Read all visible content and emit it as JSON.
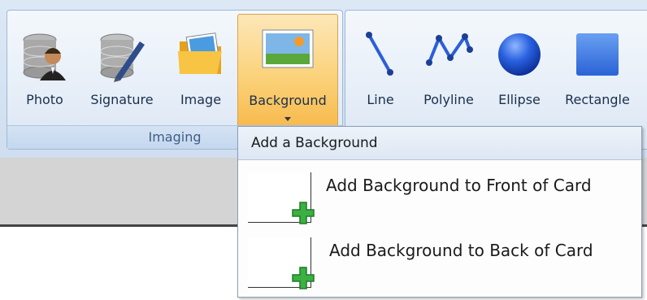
{
  "ribbon": {
    "imaging_group": {
      "caption": "Imaging",
      "buttons": [
        {
          "label": "Photo",
          "icon": "photo-database-icon"
        },
        {
          "label": "Signature",
          "icon": "signature-database-icon"
        },
        {
          "label": "Image",
          "icon": "image-folder-icon"
        },
        {
          "label": "Background",
          "icon": "background-picture-icon",
          "state": "active"
        }
      ]
    },
    "shapes_group": {
      "buttons": [
        {
          "label": "Line",
          "icon": "line-icon"
        },
        {
          "label": "Polyline",
          "icon": "polyline-icon"
        },
        {
          "label": "Ellipse",
          "icon": "ellipse-icon"
        },
        {
          "label": "Rectangle",
          "icon": "rectangle-icon"
        }
      ]
    }
  },
  "background_menu": {
    "header": "Add a Background",
    "items": [
      {
        "label": "Add Background to Front of Card",
        "icon": "add-icon"
      },
      {
        "label": "Add Background to Back of Card",
        "icon": "add-icon"
      }
    ]
  },
  "colors": {
    "active_button": "#fbd27a",
    "ribbon": "#dde8f5",
    "shape_blue": "#2b5fd9",
    "add_green": "#3cb043"
  }
}
